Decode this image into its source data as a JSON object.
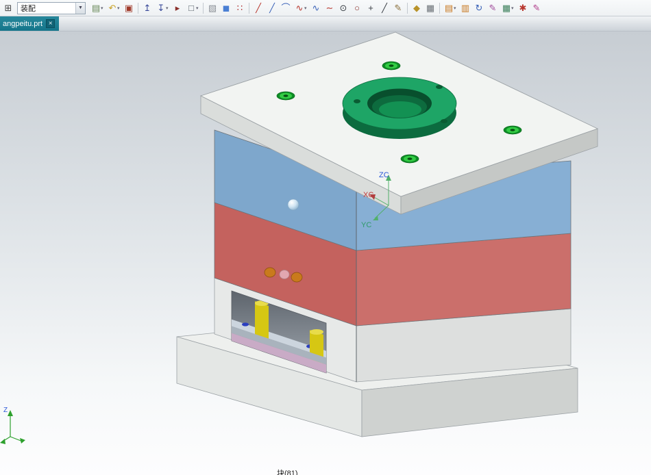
{
  "window": {
    "tab": {
      "label": "angpeitu.prt",
      "close": "×"
    }
  },
  "toolbar": {
    "lead_icon": {
      "name": "module-grid-icon",
      "glyph": "⊞"
    },
    "assembly_combo": {
      "value": "装配",
      "arrow": "▼"
    },
    "icons": [
      {
        "name": "paste-icon",
        "glyph": "▤",
        "color": "#6a8a5a",
        "dd": true
      },
      {
        "name": "undo-icon",
        "glyph": "↶",
        "color": "#c9a227",
        "dd": true
      },
      {
        "name": "clipboard-icon",
        "glyph": "▣",
        "color": "#a03a2a"
      },
      {
        "sep": true
      },
      {
        "name": "promote-body-icon",
        "glyph": "↥",
        "color": "#3a4a9a"
      },
      {
        "name": "demote-body-icon",
        "glyph": "↧",
        "color": "#3a4a9a",
        "dd": true
      },
      {
        "name": "snap-select-icon",
        "glyph": "▸",
        "color": "#8a2f2a"
      },
      {
        "name": "selection-rect-icon",
        "glyph": "□",
        "color": "#555f68",
        "dd": true
      },
      {
        "sep": true
      },
      {
        "name": "shaded-cube-icon",
        "glyph": "▧",
        "color": "#8a8f96"
      },
      {
        "name": "view-cube-icon",
        "glyph": "◼",
        "color": "#4a7fd4"
      },
      {
        "name": "snap-points-icon",
        "glyph": "∷",
        "color": "#b03030"
      },
      {
        "sep": true
      },
      {
        "name": "line-red-icon",
        "glyph": "╱",
        "color": "#b8372e"
      },
      {
        "name": "line-blue-icon",
        "glyph": "╱",
        "color": "#3a62b8"
      },
      {
        "name": "arc-icon",
        "glyph": "⌒",
        "color": "#3a62b8"
      },
      {
        "name": "spline-red-icon",
        "glyph": "∿",
        "color": "#b8372e",
        "dd": true
      },
      {
        "name": "spline-blue-icon",
        "glyph": "∿",
        "color": "#3a62b8"
      },
      {
        "name": "fit-curve-icon",
        "glyph": "∼",
        "color": "#b8372e"
      },
      {
        "name": "circle-center-icon",
        "glyph": "⊙",
        "color": "#3a3f45"
      },
      {
        "name": "circle-icon",
        "glyph": "○",
        "color": "#8a2f2a"
      },
      {
        "name": "plus-icon",
        "glyph": "+",
        "color": "#3a3f45"
      },
      {
        "name": "slash-icon",
        "glyph": "╱",
        "color": "#3a3f45"
      },
      {
        "name": "sketch-face-icon",
        "glyph": "✎",
        "color": "#8a6f3a"
      },
      {
        "sep": true
      },
      {
        "name": "datum-icon",
        "glyph": "◆",
        "color": "#b8932a"
      },
      {
        "name": "grid-icon",
        "glyph": "▦",
        "color": "#6a7076"
      },
      {
        "sep": true
      },
      {
        "name": "window-cascade-icon",
        "glyph": "▤",
        "color": "#c87820",
        "dd": true
      },
      {
        "name": "window-tile-icon",
        "glyph": "▥",
        "color": "#c87820"
      },
      {
        "name": "refresh-icon",
        "glyph": "↻",
        "color": "#3a62b8"
      },
      {
        "name": "edit-object-icon",
        "glyph": "✎",
        "color": "#a04a9a"
      },
      {
        "name": "table-icon",
        "glyph": "▦",
        "color": "#3a7f5a",
        "dd": true
      },
      {
        "name": "star-icon",
        "glyph": "✱",
        "color": "#b8372e"
      },
      {
        "name": "annotate-icon",
        "glyph": "✎",
        "color": "#b03a8a"
      }
    ]
  },
  "viewport": {
    "wcs": {
      "z_label": "ZC",
      "x_label": "XC",
      "y_label": "YC"
    },
    "view_triad": {
      "z_label": "Z"
    },
    "status_text": "块(81)"
  },
  "colors": {
    "top_plate_top": "#f2f4f2",
    "top_plate_left": "#dadddb",
    "top_plate_right": "#c5c8c6",
    "ring_green": "#1ea566",
    "ring_dark": "#0c6b3f",
    "hole_dark": "#084f2d",
    "hole_mid": "#0d6b3e",
    "hole_light": "#139153",
    "screw_outer": "#0e8c26",
    "screw_mid": "#33cc44",
    "screw_center": "#084d12",
    "a_plate_left": "#7ea7cc",
    "a_plate_right": "#87afd4",
    "b_plate_left": "#c4625e",
    "b_plate_right": "#cb6f6b",
    "lower_left": "#e7e9e8",
    "lower_right": "#dddfde",
    "base_top": "#eef0ee",
    "base_left": "#e4e7e5",
    "base_right": "#cfd2d0",
    "pin_yellow": "#d6c713",
    "pin_top": "#e8dc4a",
    "plate_top_face": "#ccd5de",
    "plate_gray": "#a9b3bd",
    "plate_pink": "#c9abc6",
    "plate_white": "#e0e4e2",
    "dot_blue": "#2b3fc0",
    "dot_orange": "#c97a1c",
    "dot_pink": "#e2a7b0",
    "edge": "#6d7378",
    "edge_light": "#9aa0a4",
    "wcs_z": "#2b58d8",
    "wcs_x": "#c23a3a",
    "wcs_y": "#2f9a6a",
    "triad_green": "#2da02d"
  }
}
